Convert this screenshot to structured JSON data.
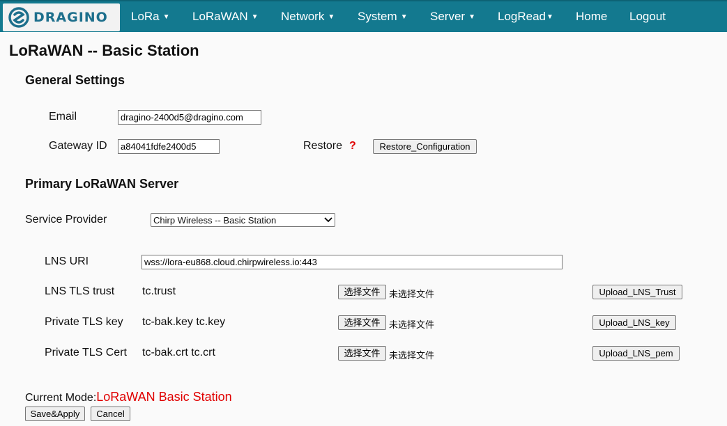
{
  "nav": {
    "logo_text": "DRAGINO",
    "items": [
      {
        "label": "LoRa",
        "dropdown": true
      },
      {
        "label": "LoRaWAN",
        "dropdown": true
      },
      {
        "label": "Network",
        "dropdown": true
      },
      {
        "label": "System",
        "dropdown": true
      },
      {
        "label": "Server",
        "dropdown": true
      },
      {
        "label": "LogRead",
        "dropdown": true
      },
      {
        "label": "Home",
        "dropdown": false
      },
      {
        "label": "Logout",
        "dropdown": false
      }
    ],
    "caret": "▼"
  },
  "page": {
    "title": "LoRaWAN -- Basic Station"
  },
  "general": {
    "title": "General Settings",
    "email_label": "Email",
    "email_value": "dragino-2400d5@dragino.com",
    "gateway_label": "Gateway ID",
    "gateway_value": "a84041fdfe2400d5",
    "restore_label": "Restore",
    "help_mark": "?",
    "restore_button": "Restore_Configuration"
  },
  "primary": {
    "title": "Primary LoRaWAN Server",
    "provider_label": "Service Provider",
    "provider_selected": "Chirp Wireless -- Basic Station",
    "uri_label": "LNS URI",
    "uri_value": "wss://lora-eu868.cloud.chirpwireless.io:443",
    "choose_file": "选择文件",
    "no_file": "未选择文件",
    "rows": [
      {
        "label": "LNS TLS trust",
        "files": "tc.trust",
        "upload": "Upload_LNS_Trust"
      },
      {
        "label": "Private TLS key",
        "files": "tc-bak.key tc.key",
        "upload": "Upload_LNS_key"
      },
      {
        "label": "Private TLS Cert",
        "files": "tc-bak.crt tc.crt",
        "upload": "Upload_LNS_pem"
      }
    ]
  },
  "footer": {
    "mode_label": "Current Mode:",
    "mode_value": "LoRaWAN Basic Station",
    "save_button": "Save&Apply",
    "cancel_button": "Cancel"
  },
  "colors": {
    "navbar": "#13798f",
    "accent_red": "#e00000"
  }
}
